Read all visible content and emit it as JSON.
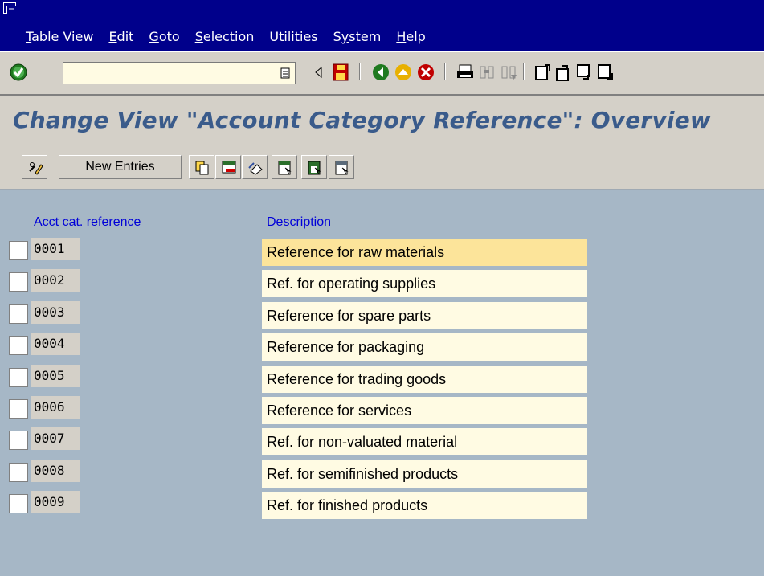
{
  "menu": {
    "items": [
      "Table View",
      "Edit",
      "Goto",
      "Selection",
      "Utilities",
      "System",
      "Help"
    ],
    "underline": [
      "T",
      "E",
      "G",
      "S",
      "",
      "y",
      "H"
    ]
  },
  "page": {
    "title": "Change View \"Account Category Reference\": Overview"
  },
  "app_toolbar": {
    "new_entries_label": "New Entries"
  },
  "table": {
    "col_key": "Acct cat. reference",
    "col_desc": "Description",
    "rows": [
      {
        "key": "0001",
        "desc": "Reference for raw materials",
        "selected": true
      },
      {
        "key": "0002",
        "desc": "Ref. for operating supplies"
      },
      {
        "key": "0003",
        "desc": "Reference for spare parts"
      },
      {
        "key": "0004",
        "desc": "Reference for packaging"
      },
      {
        "key": "0005",
        "desc": "Reference for trading goods"
      },
      {
        "key": "0006",
        "desc": "Reference for services"
      },
      {
        "key": "0007",
        "desc": "Ref. for non-valuated material"
      },
      {
        "key": "0008",
        "desc": "Ref. for semifinished products"
      },
      {
        "key": "0009",
        "desc": "Ref. for finished products"
      }
    ]
  },
  "colors": {
    "menubar": "#00008b",
    "workspace": "#a6b7c6",
    "title": "#3a5b8b",
    "field": "#fffbe3",
    "selected_field": "#fce49a"
  }
}
